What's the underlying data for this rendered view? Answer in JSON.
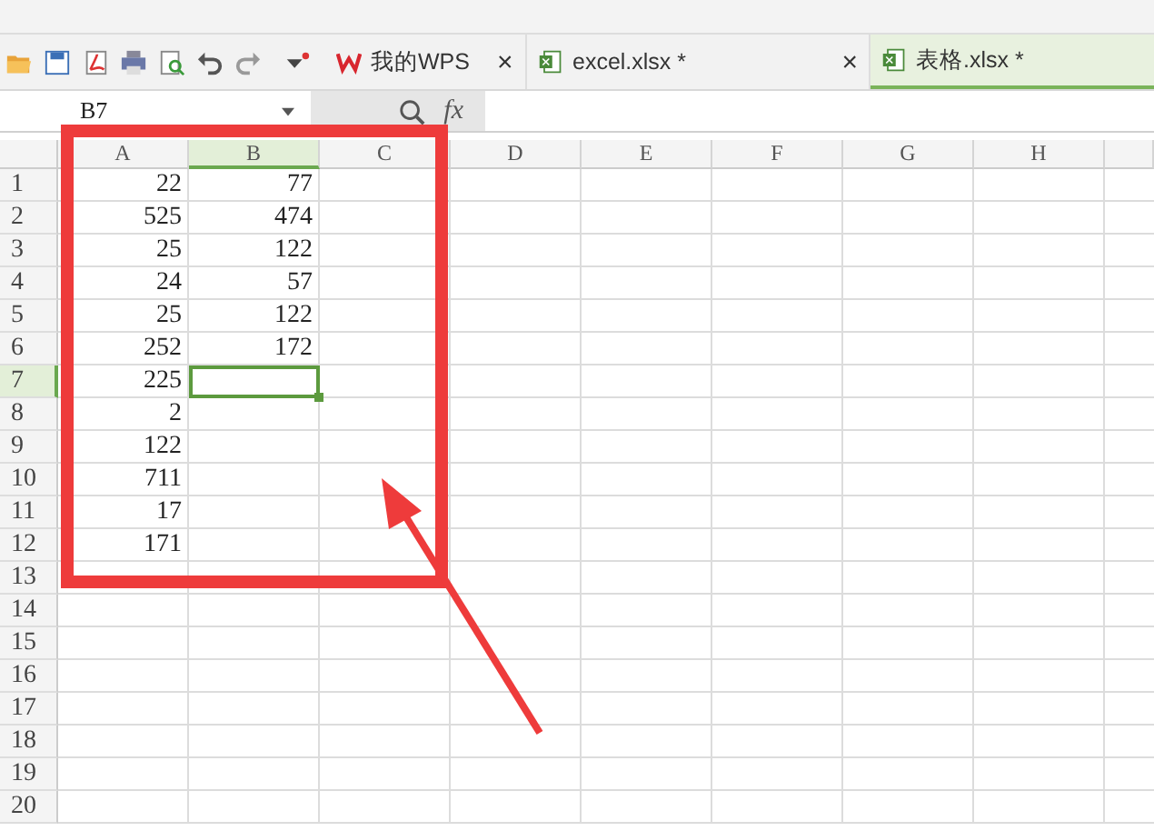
{
  "tabs": [
    {
      "label": "我的WPS",
      "kind": "home",
      "selected": false,
      "close": "×"
    },
    {
      "label": "excel.xlsx *",
      "kind": "file",
      "selected": false,
      "close": "×"
    },
    {
      "label": "表格.xlsx *",
      "kind": "file",
      "selected": true
    }
  ],
  "formula_bar": {
    "name_box": "B7",
    "fx": "fx"
  },
  "sheet": {
    "columns": [
      {
        "label": "A",
        "selected": false
      },
      {
        "label": "B",
        "selected": true
      },
      {
        "label": "C",
        "selected": false
      },
      {
        "label": "D",
        "selected": false
      },
      {
        "label": "E",
        "selected": false
      },
      {
        "label": "F",
        "selected": false
      },
      {
        "label": "G",
        "selected": false
      },
      {
        "label": "H",
        "selected": false
      }
    ],
    "rows": [
      {
        "label": "1",
        "selected": false,
        "cells": [
          {
            "text": "22",
            "selected": false
          },
          {
            "text": "77",
            "selected": false
          }
        ]
      },
      {
        "label": "2",
        "selected": false,
        "cells": [
          {
            "text": "525",
            "selected": false
          },
          {
            "text": "474",
            "selected": false
          }
        ]
      },
      {
        "label": "3",
        "selected": false,
        "cells": [
          {
            "text": "25",
            "selected": false
          },
          {
            "text": "122",
            "selected": false
          }
        ]
      },
      {
        "label": "4",
        "selected": false,
        "cells": [
          {
            "text": "24",
            "selected": false
          },
          {
            "text": "57",
            "selected": false
          }
        ]
      },
      {
        "label": "5",
        "selected": false,
        "cells": [
          {
            "text": "25",
            "selected": false
          },
          {
            "text": "122",
            "selected": false
          }
        ]
      },
      {
        "label": "6",
        "selected": false,
        "cells": [
          {
            "text": "252",
            "selected": false
          },
          {
            "text": "172",
            "selected": false
          }
        ]
      },
      {
        "label": "7",
        "selected": true,
        "cells": [
          {
            "text": "225",
            "selected": false
          },
          {
            "selected": true
          }
        ]
      },
      {
        "label": "8",
        "selected": false,
        "cells": [
          {
            "text": "2",
            "selected": false
          }
        ]
      },
      {
        "label": "9",
        "selected": false,
        "cells": [
          {
            "text": "122",
            "selected": false
          }
        ]
      },
      {
        "label": "10",
        "selected": false,
        "cells": [
          {
            "text": "711",
            "selected": false
          }
        ]
      },
      {
        "label": "11",
        "selected": false,
        "cells": [
          {
            "text": "17",
            "selected": false
          }
        ]
      },
      {
        "label": "12",
        "selected": false,
        "cells": [
          {
            "text": "171",
            "selected": false
          }
        ]
      },
      {
        "label": "13",
        "selected": false,
        "cells": []
      },
      {
        "label": "14",
        "selected": false,
        "cells": []
      },
      {
        "label": "15",
        "selected": false,
        "cells": []
      },
      {
        "label": "16",
        "selected": false,
        "cells": []
      },
      {
        "label": "17",
        "selected": false,
        "cells": []
      },
      {
        "label": "18",
        "selected": false,
        "cells": []
      },
      {
        "label": "19",
        "selected": false,
        "cells": []
      },
      {
        "label": "20",
        "selected": false,
        "cells": []
      }
    ]
  }
}
